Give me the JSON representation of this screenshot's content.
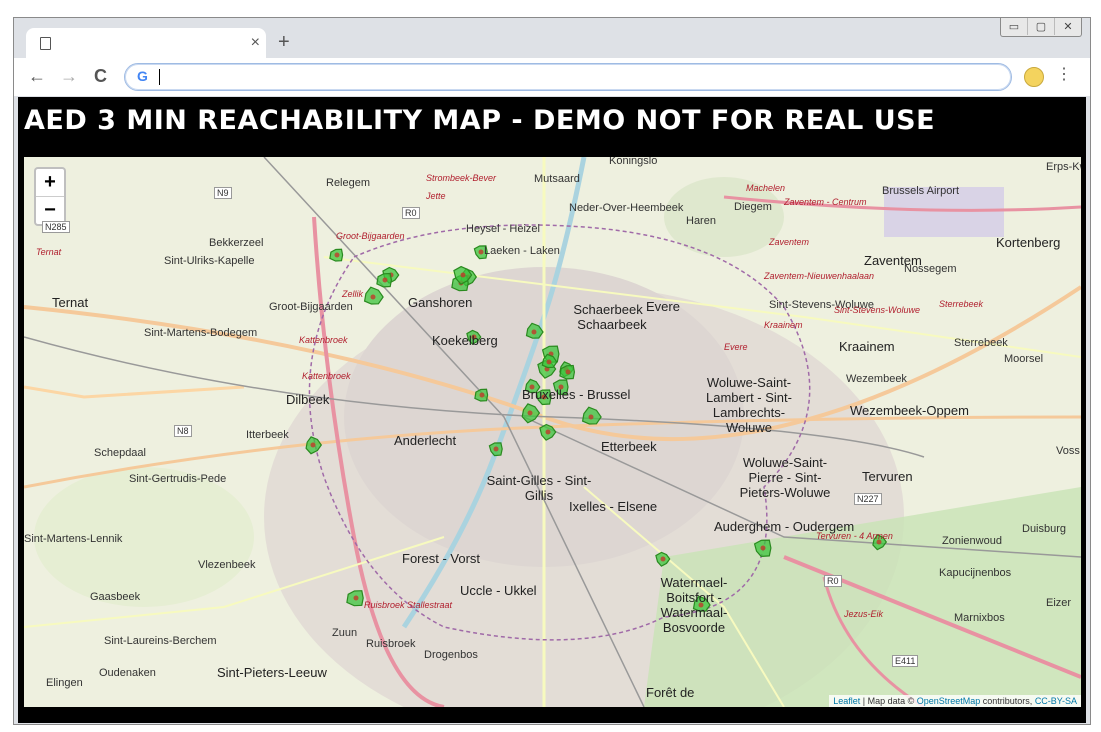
{
  "browser": {
    "tab_close": "×",
    "new_tab": "+",
    "back": "←",
    "forward": "→",
    "reload": "C",
    "omnibox_icon": "G",
    "menu": "⋮",
    "window_controls": [
      "▭",
      "▢",
      "✕"
    ]
  },
  "page": {
    "title": "AED 3 MIN REACHABILITY MAP - DEMO NOT FOR REAL USE"
  },
  "map": {
    "zoom_in": "+",
    "zoom_out": "−",
    "attribution": {
      "leaflet": "Leaflet",
      "mid": " | Map data © ",
      "osm": "OpenStreetMap",
      "contrib": " contributors, ",
      "license": "CC-BY-SA"
    },
    "place_labels": [
      {
        "text": "Koningslo",
        "cls": ""
      },
      {
        "text": "Erps-Kwe",
        "cls": ""
      },
      {
        "text": "Relegem",
        "cls": ""
      },
      {
        "text": "Strombeek-Bever",
        "cls": "red"
      },
      {
        "text": "Mutsaard",
        "cls": ""
      },
      {
        "text": "Machelen",
        "cls": "red"
      },
      {
        "text": "Brussels Airport",
        "cls": ""
      },
      {
        "text": "Jette",
        "cls": "red"
      },
      {
        "text": "Neder-Over-Heembeek",
        "cls": ""
      },
      {
        "text": "Diegem",
        "cls": ""
      },
      {
        "text": "Zaventem - Centrum",
        "cls": "red"
      },
      {
        "text": "Haren",
        "cls": ""
      },
      {
        "text": "Bekkerzeel",
        "cls": ""
      },
      {
        "text": "Groot-Bijgaarden",
        "cls": "red"
      },
      {
        "text": "Heysel - Heizel",
        "cls": ""
      },
      {
        "text": "Zaventem",
        "cls": "red"
      },
      {
        "text": "Kortenberg",
        "cls": "big"
      },
      {
        "text": "Sint-Ulriks-Kapelle",
        "cls": ""
      },
      {
        "text": "Laeken - Laken",
        "cls": ""
      },
      {
        "text": "Zaventem",
        "cls": "big"
      },
      {
        "text": "Ternat",
        "cls": "red"
      },
      {
        "text": "Zaventem-Nieuwenhaalaan",
        "cls": "red"
      },
      {
        "text": "Nossegem",
        "cls": ""
      },
      {
        "text": "Ternat",
        "cls": "big"
      },
      {
        "text": "Zellik",
        "cls": "red"
      },
      {
        "text": "Groot-Bijgaarden",
        "cls": ""
      },
      {
        "text": "Ganshoren",
        "cls": "big"
      },
      {
        "text": "Schaerbeek - Schaarbeek",
        "cls": "big"
      },
      {
        "text": "Evere",
        "cls": "big"
      },
      {
        "text": "Sint-Stevens-Woluwe",
        "cls": ""
      },
      {
        "text": "Sint-Stevens-Woluwe",
        "cls": "red"
      },
      {
        "text": "Sterrebeek",
        "cls": "red"
      },
      {
        "text": "Sint-Martens-Bodegem",
        "cls": ""
      },
      {
        "text": "Koekelberg",
        "cls": "big"
      },
      {
        "text": "Kraainem",
        "cls": "red"
      },
      {
        "text": "Kraainem",
        "cls": "big"
      },
      {
        "text": "Sterrebeek",
        "cls": ""
      },
      {
        "text": "Kattenbroek",
        "cls": "red"
      },
      {
        "text": "Evere",
        "cls": "red"
      },
      {
        "text": "Moorsel",
        "cls": ""
      },
      {
        "text": "Kattenbroek",
        "cls": "red"
      },
      {
        "text": "Woluwe-Saint-Lambert - Sint-Lambrechts-Woluwe",
        "cls": "big"
      },
      {
        "text": "Wezembeek",
        "cls": ""
      },
      {
        "text": "Bruxelles - Brussel",
        "cls": "big"
      },
      {
        "text": "Dilbeek",
        "cls": "big"
      },
      {
        "text": "Wezembeek-Oppem",
        "cls": "big"
      },
      {
        "text": "Itterbeek",
        "cls": ""
      },
      {
        "text": "Anderlecht",
        "cls": "big"
      },
      {
        "text": "Etterbeek",
        "cls": "big"
      },
      {
        "text": "Schepdaal",
        "cls": ""
      },
      {
        "text": "Woluwe-Saint-Pierre - Sint-Pieters-Woluwe",
        "cls": "big"
      },
      {
        "text": "Sint-Gertrudis-Pede",
        "cls": ""
      },
      {
        "text": "Saint-Gilles - Sint-Gillis",
        "cls": "big"
      },
      {
        "text": "Tervuren",
        "cls": "big"
      },
      {
        "text": "Ixelles - Elsene",
        "cls": "big"
      },
      {
        "text": "Auderghem - Oudergem",
        "cls": "big"
      },
      {
        "text": "Tervuren - 4 Armen",
        "cls": "red"
      },
      {
        "text": "Duisburg",
        "cls": ""
      },
      {
        "text": "Zonienwoud",
        "cls": ""
      },
      {
        "text": "Sint-Martens-Lennik",
        "cls": ""
      },
      {
        "text": "Vlezenbeek",
        "cls": ""
      },
      {
        "text": "Forest - Vorst",
        "cls": "big"
      },
      {
        "text": "Kapucijnenbos",
        "cls": ""
      },
      {
        "text": "Watermael-Boitsfort - Watermaal-Bosvoorde",
        "cls": "big"
      },
      {
        "text": "Uccle - Ukkel",
        "cls": "big"
      },
      {
        "text": "Gaasbeek",
        "cls": ""
      },
      {
        "text": "Ruisbroek Stallestraat",
        "cls": "red"
      },
      {
        "text": "Eizer",
        "cls": ""
      },
      {
        "text": "Marnixbos",
        "cls": ""
      },
      {
        "text": "Zuun",
        "cls": ""
      },
      {
        "text": "Jezus-Eik",
        "cls": "red"
      },
      {
        "text": "Sint-Laureins-Berchem",
        "cls": ""
      },
      {
        "text": "Ruisbroek",
        "cls": ""
      },
      {
        "text": "Drogenbos",
        "cls": ""
      },
      {
        "text": "Oudenaken",
        "cls": ""
      },
      {
        "text": "Sint-Pieters-Leeuw",
        "cls": "big"
      },
      {
        "text": "Elingen",
        "cls": ""
      },
      {
        "text": "Forêt de",
        "cls": "big"
      },
      {
        "text": "Voss",
        "cls": ""
      }
    ],
    "road_labels": [
      "N9",
      "R0",
      "N285",
      "N8",
      "N227",
      "R0",
      "E411"
    ],
    "aed_count": 38
  }
}
